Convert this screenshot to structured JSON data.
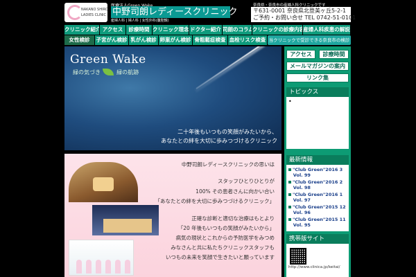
{
  "header": {
    "logo_line1": "NAKANO SHIRO",
    "logo_line2": "LADIES CLINIC",
    "subtitle": "医療法人Green Wake",
    "title": "中野司朗レディースクリニック",
    "tagline": "産婦人科 | 婦人科 | 女性外科(腹腔鏡)",
    "address_note": "奈良県・奈良市の産婦人科クリニックです",
    "address_line1": "〒631-0001 奈良県北登美ヶ丘5-2-1",
    "address_line2": "ご予約・お問い合せ TEL 0742-51-0101"
  },
  "nav_main": [
    "クリニック紹介",
    "アクセス",
    "診療時間",
    "クリニック理念",
    "ドクター紹介",
    "司朗のコラム",
    "クリニックの診療内容",
    "産婦人科疾患の解説"
  ],
  "nav_sub": [
    "女性検診",
    "子宮がん検診",
    "乳がん検診",
    "卵巣がん検診",
    "骨粗鬆症検査",
    "血栓リスク検査",
    "当クリニックで受診できる奈良市の検診"
  ],
  "hero": {
    "title": "Green Wake",
    "subtitle_a": "緑の気づき",
    "subtitle_b": "緑の航跡",
    "line1": "二十年後もいつもの笑顔がみたいから、",
    "line2": "あなたとの絆を大切に歩みつづけるクリニック"
  },
  "message": [
    "中野司朗レディースクリニックの思いは",
    "スタッフひとりひとりが",
    "100% その患者さんに向かい合い",
    "「あなたとの絆を大切に歩みつづけるクリニック」",
    "正確な診断と適切な治療はもとより",
    "「20 年後もいつもの笑顔がみたいから」",
    "病気の現状とこれからの予防医学をみつめ",
    "みなさんと共に私たちクリニックスタッフも",
    "いつもの未来を笑顔で生きたいと願っています"
  ],
  "sidebar": {
    "access": "アクセス",
    "hours": "診療時間",
    "mailmag": "メールマガジンの案内",
    "links": "リンク集",
    "topics_title": "トピックス",
    "topics_item": "•",
    "news_title": "最新情報",
    "news": [
      {
        "title": "\"Club Green\"2016 3",
        "vol": "Vol. 99"
      },
      {
        "title": "\"Club Green\"2016 2",
        "vol": "Vol. 98"
      },
      {
        "title": "\"Club Green\"2016 1",
        "vol": "Vol. 97"
      },
      {
        "title": "\"Club Green\"2015 12",
        "vol": "Vol. 96"
      },
      {
        "title": "\"Club Green\"2015 11",
        "vol": "Vol. 95"
      }
    ],
    "mobile_title": "携帯版サイト",
    "mobile_url": "http://www.clinica.jp/keitai/"
  },
  "colors": {
    "accent": "#0d9b74",
    "nav": "#0e9b7c",
    "title_bg": "#0b9a93",
    "pink": "#fde3ea"
  }
}
